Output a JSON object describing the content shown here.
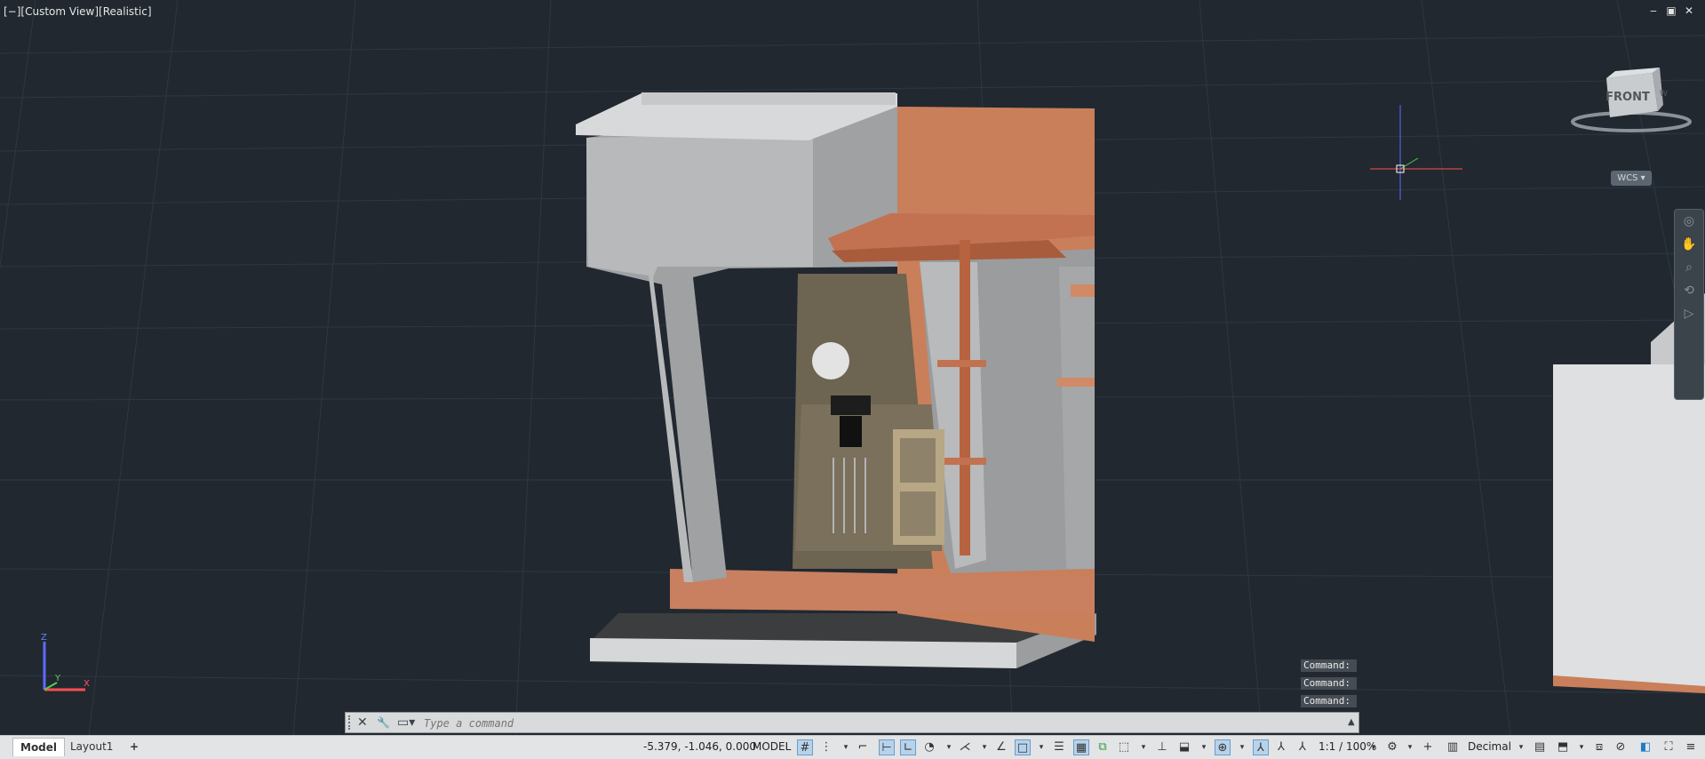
{
  "viewport": {
    "label": "[−][Custom View][Realistic]",
    "window_controls": {
      "minimize": "‒",
      "restore": "▣",
      "close": "✕"
    },
    "viewcube_face": "FRONT",
    "viewcube_side": "W",
    "wcs_label": "WCS",
    "ucs_axes": {
      "x": "X",
      "y": "Y",
      "z": "Z"
    },
    "navbar_icons": [
      "steering-wheel",
      "pan",
      "zoom",
      "orbit",
      "showmotion"
    ],
    "colors": {
      "background": "#212830",
      "terracotta": "#c97f5a",
      "concrete": "#a5a7a9",
      "grid": "#2d3540"
    }
  },
  "command_history": [
    "Command:",
    "Command:",
    "Command:"
  ],
  "command_line": {
    "placeholder": "Type a command",
    "close_icon": "✕",
    "customize_icon": "🔧",
    "recent_icon": "▭"
  },
  "status": {
    "tabs": [
      {
        "label": "Model",
        "active": true
      },
      {
        "label": "Layout1",
        "active": false
      }
    ],
    "add_layout": "+",
    "coordinates": "-5.379, -1.046, 0.000",
    "space": "MODEL",
    "annotation_scale": "1:1 / 100%",
    "units": "Decimal"
  }
}
